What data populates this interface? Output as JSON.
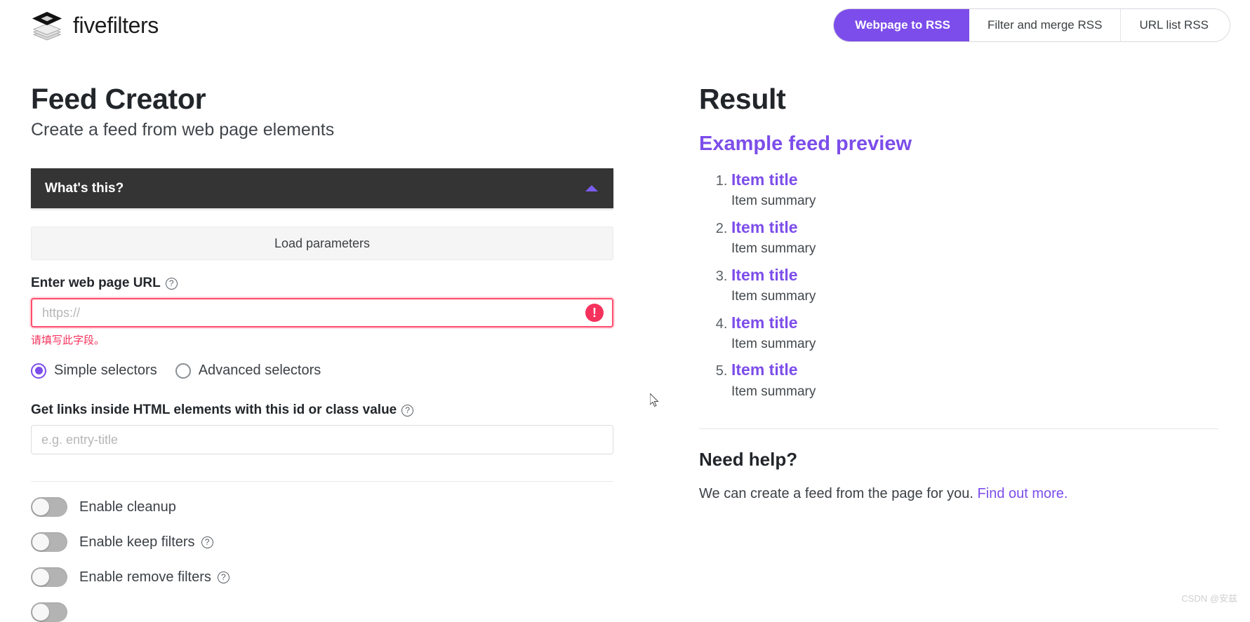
{
  "header": {
    "brand_name": "fivefilters",
    "nav": [
      {
        "label": "Webpage to RSS",
        "active": true
      },
      {
        "label": "Filter and merge RSS",
        "active": false
      },
      {
        "label": "URL list RSS",
        "active": false
      }
    ]
  },
  "left": {
    "title": "Feed Creator",
    "subtitle": "Create a feed from web page elements",
    "whats_this_label": "What's this?",
    "load_parameters_label": "Load parameters",
    "url_field": {
      "label": "Enter web page URL",
      "placeholder": "https://",
      "value": "",
      "error_message": "请填写此字段。"
    },
    "selector_mode": {
      "options": [
        {
          "label": "Simple selectors",
          "selected": true
        },
        {
          "label": "Advanced selectors",
          "selected": false
        }
      ]
    },
    "links_field": {
      "label": "Get links inside HTML elements with this id or class value",
      "placeholder": "e.g. entry-title",
      "value": ""
    },
    "toggles": [
      {
        "label": "Enable cleanup",
        "on": false,
        "has_help": false
      },
      {
        "label": "Enable keep filters",
        "on": false,
        "has_help": true
      },
      {
        "label": "Enable remove filters",
        "on": false,
        "has_help": true
      },
      {
        "label": "",
        "on": false,
        "has_help": false
      }
    ]
  },
  "right": {
    "title": "Result",
    "preview_link": "Example feed preview",
    "items": [
      {
        "title": "Item title",
        "summary": "Item summary"
      },
      {
        "title": "Item title",
        "summary": "Item summary"
      },
      {
        "title": "Item title",
        "summary": "Item summary"
      },
      {
        "title": "Item title",
        "summary": "Item summary"
      },
      {
        "title": "Item title",
        "summary": "Item summary"
      }
    ],
    "need_help_title": "Need help?",
    "help_text": "We can create a feed from the page for you.",
    "help_link": "Find out more."
  },
  "watermark": "CSDN @安兹",
  "colors": {
    "accent": "#7c4dea",
    "error": "#f5325c",
    "dark_bar": "#343434"
  },
  "icons": {
    "help": "?",
    "error": "!"
  }
}
